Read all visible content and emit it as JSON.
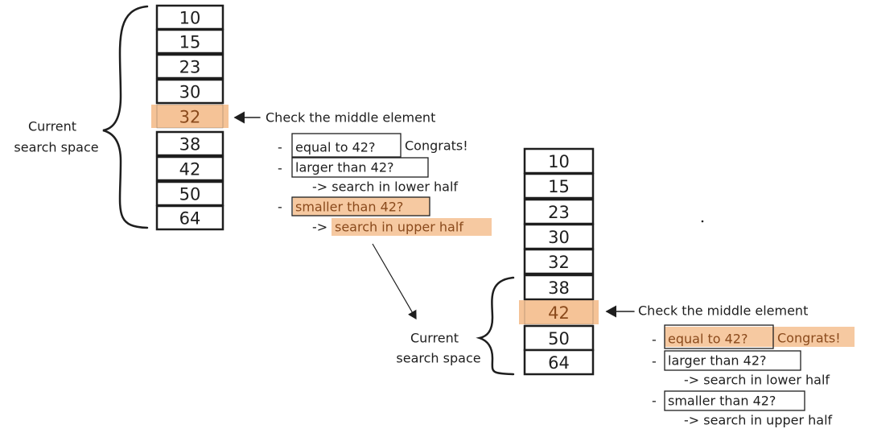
{
  "colors": {
    "highlight": "#f5c397",
    "highlight_text": "#8a4a1c",
    "ink": "#1e1e1e"
  },
  "left": {
    "array": [
      "10",
      "15",
      "23",
      "30",
      "32",
      "38",
      "42",
      "50",
      "64"
    ],
    "highlighted_index": 4,
    "brace_label": [
      "Current",
      "search space"
    ],
    "pointer_text": "Check the middle element",
    "bullets": {
      "dash": "-",
      "equal": "equal to 42?",
      "congrats": "Congrats!",
      "larger": "larger than 42?",
      "lower": "-> search in lower half",
      "smaller": "smaller than 42?",
      "upper": "-> search in upper half"
    }
  },
  "right": {
    "array": [
      "10",
      "15",
      "23",
      "30",
      "32",
      "38",
      "42",
      "50",
      "64"
    ],
    "highlighted_index": 6,
    "brace_label": [
      "Current",
      "search space"
    ],
    "pointer_text": "Check the middle element",
    "bullets": {
      "dash": "-",
      "equal": "equal to 42?",
      "congrats": "Congrats!",
      "larger": "larger than 42?",
      "lower": "-> search in lower half",
      "smaller": "smaller than 42?",
      "upper": "-> search in upper half"
    }
  }
}
